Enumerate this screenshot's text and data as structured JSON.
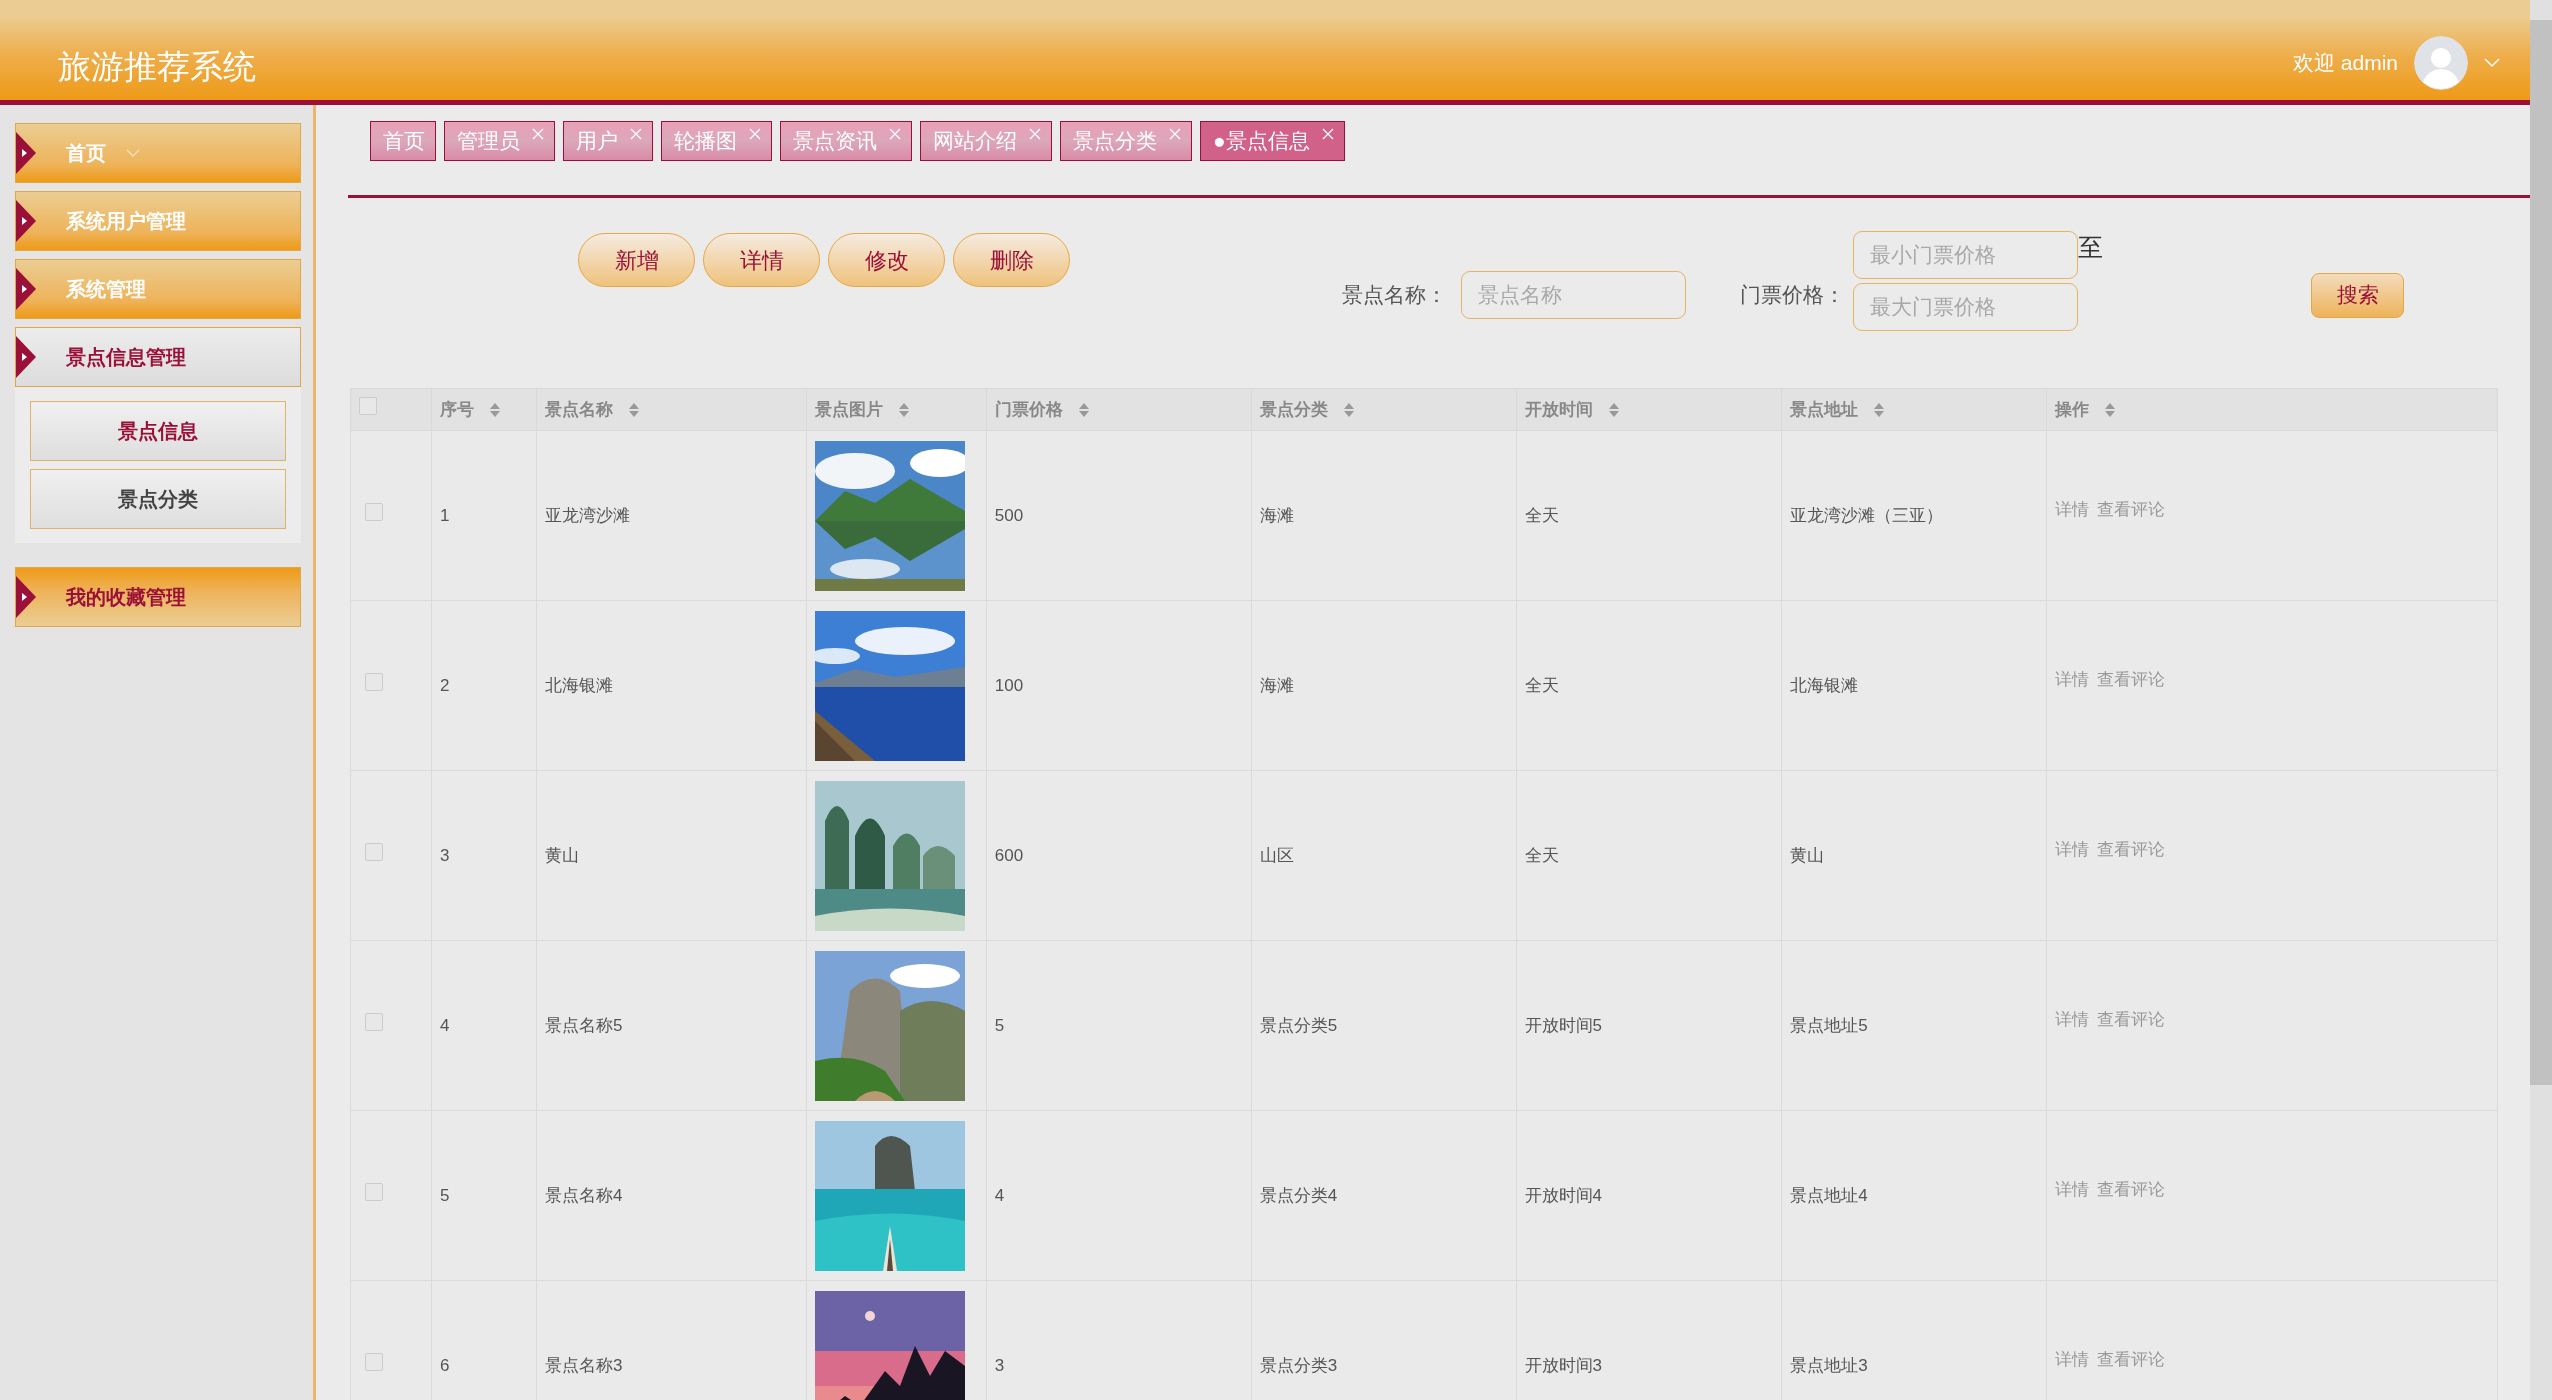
{
  "header": {
    "title": "旅游推荐系统",
    "welcome": "欢迎 admin"
  },
  "sidebar": {
    "items": [
      {
        "label": "首页",
        "dropdown": true,
        "selected": false,
        "hovered": false
      },
      {
        "label": "系统用户管理",
        "dropdown": false,
        "selected": false,
        "hovered": false
      },
      {
        "label": "系统管理",
        "dropdown": false,
        "selected": false,
        "hovered": false
      },
      {
        "label": "景点信息管理",
        "dropdown": false,
        "selected": true,
        "hovered": false,
        "children": [
          {
            "label": "景点信息",
            "selected": true
          },
          {
            "label": "景点分类",
            "selected": false
          }
        ]
      },
      {
        "label": "我的收藏管理",
        "dropdown": false,
        "selected": false,
        "hovered": true
      }
    ]
  },
  "tabs": [
    {
      "label": "首页",
      "closable": false,
      "selected": false
    },
    {
      "label": "管理员",
      "closable": true,
      "selected": false
    },
    {
      "label": "用户",
      "closable": true,
      "selected": false
    },
    {
      "label": "轮播图",
      "closable": true,
      "selected": false
    },
    {
      "label": "景点资讯",
      "closable": true,
      "selected": false
    },
    {
      "label": "网站介绍",
      "closable": true,
      "selected": false
    },
    {
      "label": "景点分类",
      "closable": true,
      "selected": false
    },
    {
      "label": "●景点信息",
      "closable": true,
      "selected": true
    }
  ],
  "toolbar": {
    "buttons": [
      "新增",
      "详情",
      "修改",
      "删除"
    ]
  },
  "search": {
    "name_label": "景点名称：",
    "name_placeholder": "景点名称",
    "price_label": "门票价格：",
    "min_placeholder": "最小门票价格",
    "max_placeholder": "最大门票价格",
    "range_separator": "至",
    "button": "搜索"
  },
  "table": {
    "header_checked": false,
    "columns": [
      "序号",
      "景点名称",
      "景点图片",
      "门票价格",
      "景点分类",
      "开放时间",
      "景点地址",
      "操作"
    ],
    "rows": [
      {
        "checked": false,
        "no": "1",
        "name": "亚龙湾沙滩",
        "price": "500",
        "category": "海滩",
        "open_time": "全天",
        "address": "亚龙湾沙滩（三亚）",
        "actions": [
          "详情",
          "查看评论"
        ]
      },
      {
        "checked": false,
        "no": "2",
        "name": "北海银滩",
        "price": "100",
        "category": "海滩",
        "open_time": "全天",
        "address": "北海银滩",
        "actions": [
          "详情",
          "查看评论"
        ]
      },
      {
        "checked": false,
        "no": "3",
        "name": "黄山",
        "price": "600",
        "category": "山区",
        "open_time": "全天",
        "address": "黄山",
        "actions": [
          "详情",
          "查看评论"
        ]
      },
      {
        "checked": false,
        "no": "4",
        "name": "景点名称5",
        "price": "5",
        "category": "景点分类5",
        "open_time": "开放时间5",
        "address": "景点地址5",
        "actions": [
          "详情",
          "查看评论"
        ]
      },
      {
        "checked": false,
        "no": "5",
        "name": "景点名称4",
        "price": "4",
        "category": "景点分类4",
        "open_time": "开放时间4",
        "address": "景点地址4",
        "actions": [
          "详情",
          "查看评论"
        ]
      },
      {
        "checked": false,
        "no": "6",
        "name": "景点名称3",
        "price": "3",
        "category": "景点分类3",
        "open_time": "开放时间3",
        "address": "景点地址3",
        "actions": [
          "详情",
          "查看评论"
        ]
      }
    ]
  }
}
